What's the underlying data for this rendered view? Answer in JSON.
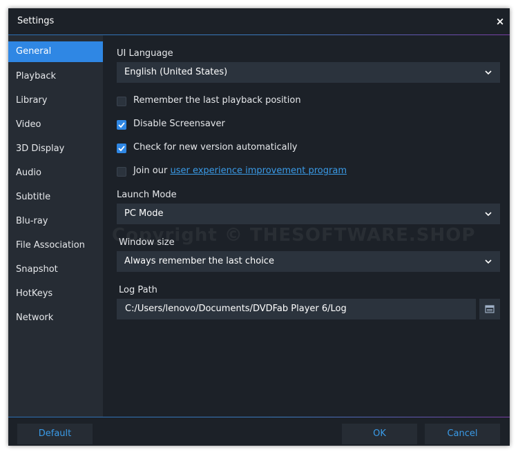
{
  "window": {
    "title": "Settings",
    "close_icon": "×"
  },
  "sidebar": {
    "items": [
      {
        "label": "General",
        "active": true
      },
      {
        "label": "Playback"
      },
      {
        "label": "Library"
      },
      {
        "label": "Video"
      },
      {
        "label": "3D Display"
      },
      {
        "label": "Audio"
      },
      {
        "label": "Subtitle"
      },
      {
        "label": "Blu-ray"
      },
      {
        "label": "File Association"
      },
      {
        "label": "Snapshot"
      },
      {
        "label": "HotKeys"
      },
      {
        "label": "Network"
      }
    ]
  },
  "general": {
    "ui_language_label": "UI Language",
    "ui_language_value": "English (United States)",
    "remember_playback": {
      "label": "Remember the last playback position",
      "checked": false
    },
    "disable_screensaver": {
      "label": "Disable Screensaver",
      "checked": true
    },
    "check_version": {
      "label": "Check for new version automatically",
      "checked": true
    },
    "join_program": {
      "label_prefix": "Join our",
      "link_text": "user experience improvement program",
      "checked": false
    },
    "launch_mode_label": "Launch Mode",
    "launch_mode_value": "PC Mode",
    "window_size_label": "Window size",
    "window_size_value": "Always remember the last choice",
    "log_path_label": "Log Path",
    "log_path_value": "C:/Users/lenovo/Documents/DVDFab Player 6/Log"
  },
  "watermark": "Copyright © THESOFTWARE.SHOP",
  "footer": {
    "default_label": "Default",
    "ok_label": "OK",
    "cancel_label": "Cancel"
  },
  "colors": {
    "accent": "#2f87e4",
    "link": "#3a9be8",
    "background": "#1c2128",
    "sidebar": "#262c34",
    "field": "#2b333d"
  }
}
